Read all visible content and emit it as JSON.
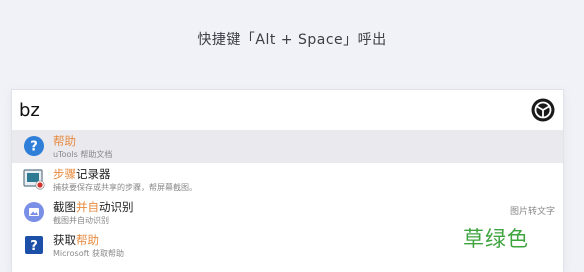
{
  "hint": "快捷键「Alt + Space」呼出",
  "search": {
    "value": "bz"
  },
  "results": [
    {
      "title_pre": "",
      "title_hl": "帮助",
      "title_post": "",
      "desc": "uTools 帮助文档",
      "tag": ""
    },
    {
      "title_pre": "",
      "title_hl": "步骤",
      "title_post": "记录器",
      "desc": "捕获要保存或共享的步骤，帮屏幕截图。",
      "tag": ""
    },
    {
      "title_pre": "截图",
      "title_hl": "并自",
      "title_post": "动识别",
      "desc": "截图并自动识别",
      "tag": "图片转文字"
    },
    {
      "title_pre": "获取",
      "title_hl": "帮助",
      "title_post": "",
      "desc": "Microsoft 获取帮助",
      "tag": ""
    }
  ],
  "watermark": "草绿色",
  "colors": {
    "highlight": "#e88a3f",
    "selected_bg": "#e9e9ee",
    "watermark": "#3ea43e"
  },
  "icons": [
    "question-icon",
    "steps-recorder-icon",
    "image-ocr-icon",
    "get-help-icon",
    "utools-logo-icon"
  ]
}
